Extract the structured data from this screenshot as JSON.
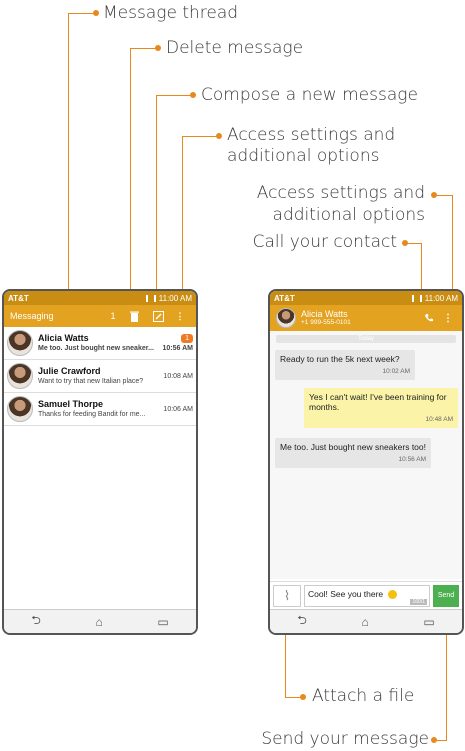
{
  "callouts": {
    "message_thread": "Message thread",
    "delete_message": "Delete message",
    "compose": "Compose a new message",
    "left_settings_1": "Access settings and",
    "left_settings_2": "additional options",
    "right_settings_1": "Access settings and",
    "right_settings_2": "additional options",
    "call_contact": "Call your contact",
    "attach_file": "Attach a file",
    "send_message": "Send your message"
  },
  "left_phone": {
    "carrier": "AT&T",
    "time": "11:00 AM",
    "title": "Messaging",
    "count": "1",
    "threads": [
      {
        "name": "Alicia Watts",
        "snippet": "Me too. Just bought new sneaker...",
        "time": "10:56 AM",
        "badge": "1"
      },
      {
        "name": "Julie Crawford",
        "snippet": "Want to try that new Italian place?",
        "time": "10:08 AM"
      },
      {
        "name": "Samuel Thorpe",
        "snippet": "Thanks for feeding Bandit for me...",
        "time": "10:06 AM"
      }
    ]
  },
  "right_phone": {
    "carrier": "AT&T",
    "time": "11:00 AM",
    "contact_name": "Alicia Watts",
    "contact_number": "+1 999-555-0101",
    "date_divider": "Today",
    "messages": [
      {
        "text": "Ready to run the 5k next week?",
        "time": "10:02 AM",
        "dir": "in"
      },
      {
        "text": "Yes I can't wait! I've been training for months.",
        "time": "10:48 AM",
        "dir": "out"
      },
      {
        "text": "Me too. Just bought new sneakers too!",
        "time": "10:56 AM",
        "dir": "in"
      }
    ],
    "compose_value": "Cool! See you there",
    "char_count": "160/1",
    "send_label": "Send"
  },
  "colors": {
    "accent": "#e3a21f",
    "callout_line": "#e8891c",
    "send": "#4caf50"
  },
  "icons": [
    "trash-icon",
    "compose-icon",
    "overflow-menu-icon",
    "phone-icon",
    "paperclip-icon",
    "back-icon",
    "home-icon",
    "recents-icon"
  ]
}
